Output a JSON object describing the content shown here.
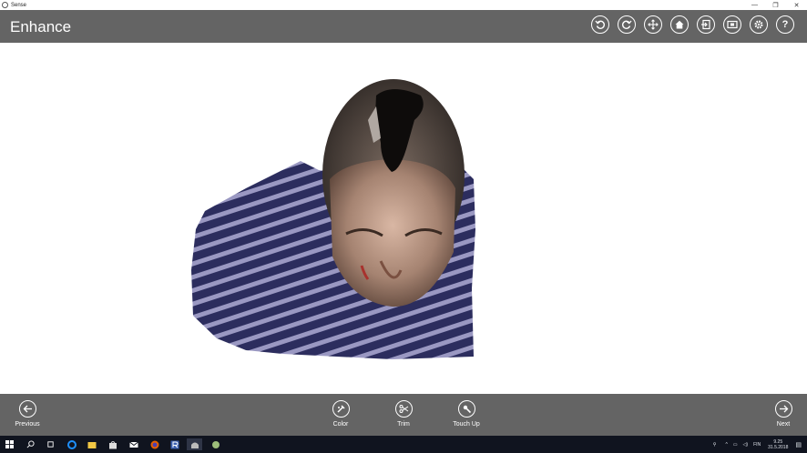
{
  "window": {
    "app_name": "Sense",
    "minimize": "—",
    "restore": "❐",
    "close": "✕"
  },
  "header": {
    "title": "Enhance",
    "tools": [
      {
        "name": "undo-icon"
      },
      {
        "name": "redo-icon"
      },
      {
        "name": "move-icon"
      },
      {
        "name": "home-icon"
      },
      {
        "name": "export-icon"
      },
      {
        "name": "view-icon"
      },
      {
        "name": "settings-icon"
      },
      {
        "name": "help-icon",
        "glyph": "?"
      }
    ]
  },
  "bottom_bar": {
    "previous_label": "Previous",
    "color_label": "Color",
    "trim_label": "Trim",
    "touchup_label": "Touch Up",
    "next_label": "Next"
  },
  "taskbar": {
    "tray_lang": "FIN",
    "time": "9.25",
    "date": "31.5.2018"
  },
  "colors": {
    "toolbar": "#646464",
    "background": "#ffffff",
    "taskbar": "#10141f"
  }
}
